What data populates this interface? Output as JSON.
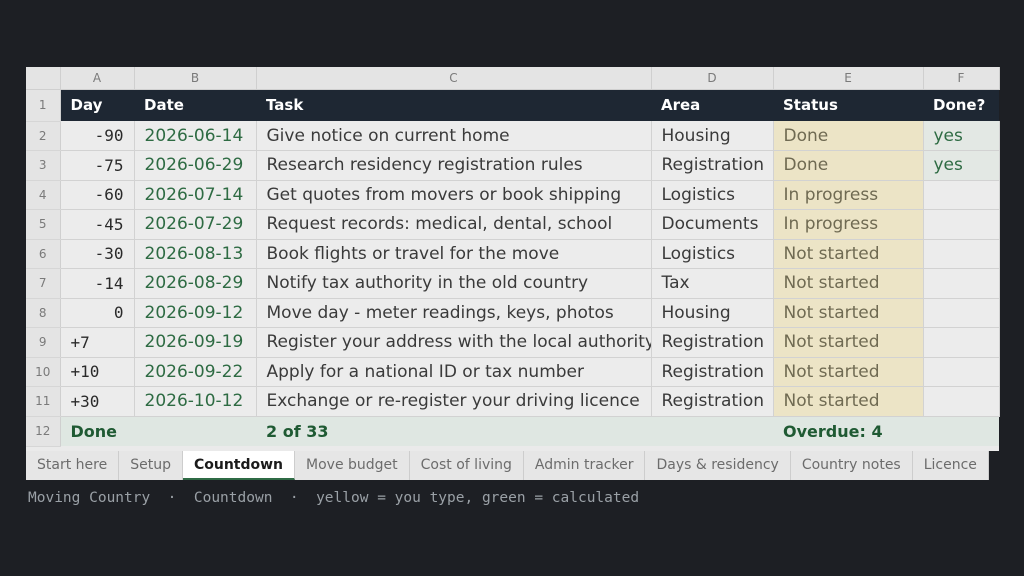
{
  "columns": [
    "A",
    "B",
    "C",
    "D",
    "E",
    "F"
  ],
  "header": {
    "day": "Day",
    "date": "Date",
    "task": "Task",
    "area": "Area",
    "status": "Status",
    "done": "Done?"
  },
  "rows": [
    {
      "num": "2",
      "day": "-90",
      "date": "2026-06-14",
      "task": "Give notice on current home",
      "area": "Housing",
      "status": "Done",
      "done": "yes"
    },
    {
      "num": "3",
      "day": "-75",
      "date": "2026-06-29",
      "task": "Research residency registration rules",
      "area": "Registration",
      "status": "Done",
      "done": "yes"
    },
    {
      "num": "4",
      "day": "-60",
      "date": "2026-07-14",
      "task": "Get quotes from movers or book shipping",
      "area": "Logistics",
      "status": "In progress",
      "done": ""
    },
    {
      "num": "5",
      "day": "-45",
      "date": "2026-07-29",
      "task": "Request records: medical, dental, school",
      "area": "Documents",
      "status": "In progress",
      "done": ""
    },
    {
      "num": "6",
      "day": "-30",
      "date": "2026-08-13",
      "task": "Book flights or travel for the move",
      "area": "Logistics",
      "status": "Not started",
      "done": ""
    },
    {
      "num": "7",
      "day": "-14",
      "date": "2026-08-29",
      "task": "Notify tax authority in the old country",
      "area": "Tax",
      "status": "Not started",
      "done": ""
    },
    {
      "num": "8",
      "day": "0",
      "date": "2026-09-12",
      "task": "Move day - meter readings, keys, photos",
      "area": "Housing",
      "status": "Not started",
      "done": ""
    },
    {
      "num": "9",
      "day": "+7",
      "date": "2026-09-19",
      "task": "Register your address with the local authority",
      "area": "Registration",
      "status": "Not started",
      "done": ""
    },
    {
      "num": "10",
      "day": "+10",
      "date": "2026-09-22",
      "task": "Apply for a national ID or tax number",
      "area": "Registration",
      "status": "Not started",
      "done": ""
    },
    {
      "num": "11",
      "day": "+30",
      "date": "2026-10-12",
      "task": "Exchange or re-register your driving licence",
      "area": "Registration",
      "status": "Not started",
      "done": ""
    }
  ],
  "header_row_num": "1",
  "total_row": {
    "num": "12",
    "label": "Done",
    "count": "2 of 33",
    "overdue": "Overdue: 4"
  },
  "tabs": [
    "Start here",
    "Setup",
    "Countdown",
    "Move budget",
    "Cost of living",
    "Admin tracker",
    "Days & residency",
    "Country notes",
    "Licence"
  ],
  "active_tab": "Countdown",
  "caption": "Moving Country  ·  Countdown  ·  yellow = you type, green = calculated",
  "colors": {
    "header_bg": "#1e2733",
    "date_green": "#2e6b43",
    "input_yellow": "#ece4c6",
    "calc_green": "#e3e8e4"
  }
}
